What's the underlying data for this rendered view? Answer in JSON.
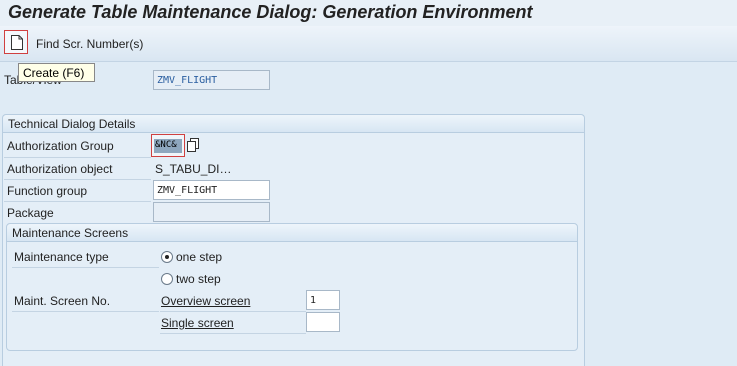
{
  "title": "Generate Table Maintenance Dialog: Generation Environment",
  "toolbar": {
    "create_icon": "new-document-icon",
    "find_label": "Find Scr. Number(s)"
  },
  "tooltip": "Create   (F6)",
  "table_view": {
    "label": "Table/View",
    "value": "ZMV_FLIGHT"
  },
  "technical_details": {
    "title": "Technical Dialog Details",
    "auth_group_label": "Authorization Group",
    "auth_group_value": "&NC&",
    "auth_object_label": "Authorization object",
    "auth_object_value": "S_TABU_DI…",
    "function_group_label": "Function group",
    "function_group_value": "ZMV_FLIGHT",
    "package_label": "Package",
    "package_value": ""
  },
  "maintenance_screens": {
    "title": "Maintenance Screens",
    "type_label": "Maintenance type",
    "one_step": "one step",
    "two_step": "two step",
    "selected": "one step",
    "screen_no_label": "Maint. Screen No.",
    "overview_label": "Overview screen",
    "overview_value": "1",
    "single_label": "Single screen",
    "single_value": ""
  }
}
